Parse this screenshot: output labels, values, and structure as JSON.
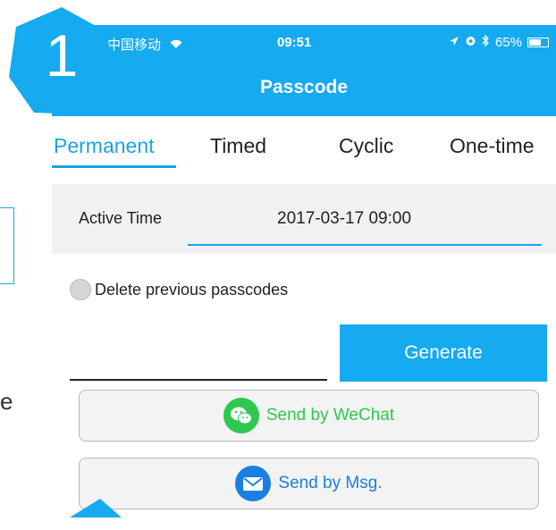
{
  "status_bar": {
    "carrier": "中国移动",
    "time": "09:51",
    "battery": "65%",
    "battery_level": 0.65
  },
  "nav": {
    "title": "Passcode"
  },
  "tabs": [
    {
      "label": "Permanent",
      "active": true
    },
    {
      "label": "Timed",
      "active": false
    },
    {
      "label": "Cyclic",
      "active": false
    },
    {
      "label": "One-time",
      "active": false
    }
  ],
  "active_time": {
    "label": "Active Time",
    "value": "2017-03-17 09:00"
  },
  "delete_option": {
    "label": "Delete previous passcodes",
    "checked": false
  },
  "generate_button": {
    "label": "Generate"
  },
  "send_wechat": {
    "label": "Send by WeChat"
  },
  "send_msg": {
    "label": "Send by Msg."
  },
  "step_badge": {
    "number": "1"
  },
  "page_fragment": {
    "letter": "e"
  },
  "colors": {
    "accent": "#16aaf0",
    "wechat": "#2ec84f",
    "msg": "#1a7fe0"
  }
}
